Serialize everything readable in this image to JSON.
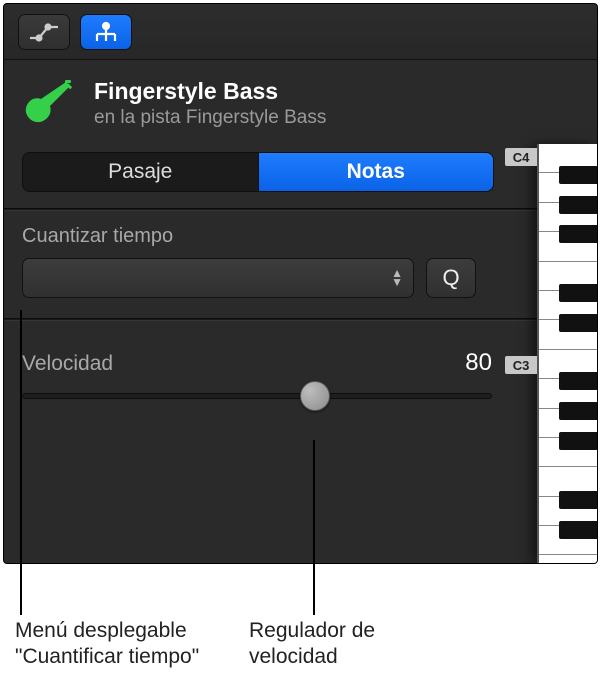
{
  "track": {
    "title": "Fingerstyle Bass",
    "subtitle": "en la pista Fingerstyle Bass"
  },
  "segmented": {
    "pasaje": "Pasaje",
    "notas": "Notas"
  },
  "quantize": {
    "label": "Cuantizar tiempo",
    "value": "",
    "button": "Q"
  },
  "velocity": {
    "label": "Velocidad",
    "value": "80"
  },
  "piano": {
    "c4": "C4",
    "c3": "C3"
  },
  "callouts": {
    "quant_menu_l1": "Menú desplegable",
    "quant_menu_l2": "\"Cuantificar tiempo\"",
    "vel_slider_l1": "Regulador de",
    "vel_slider_l2": "velocidad"
  }
}
